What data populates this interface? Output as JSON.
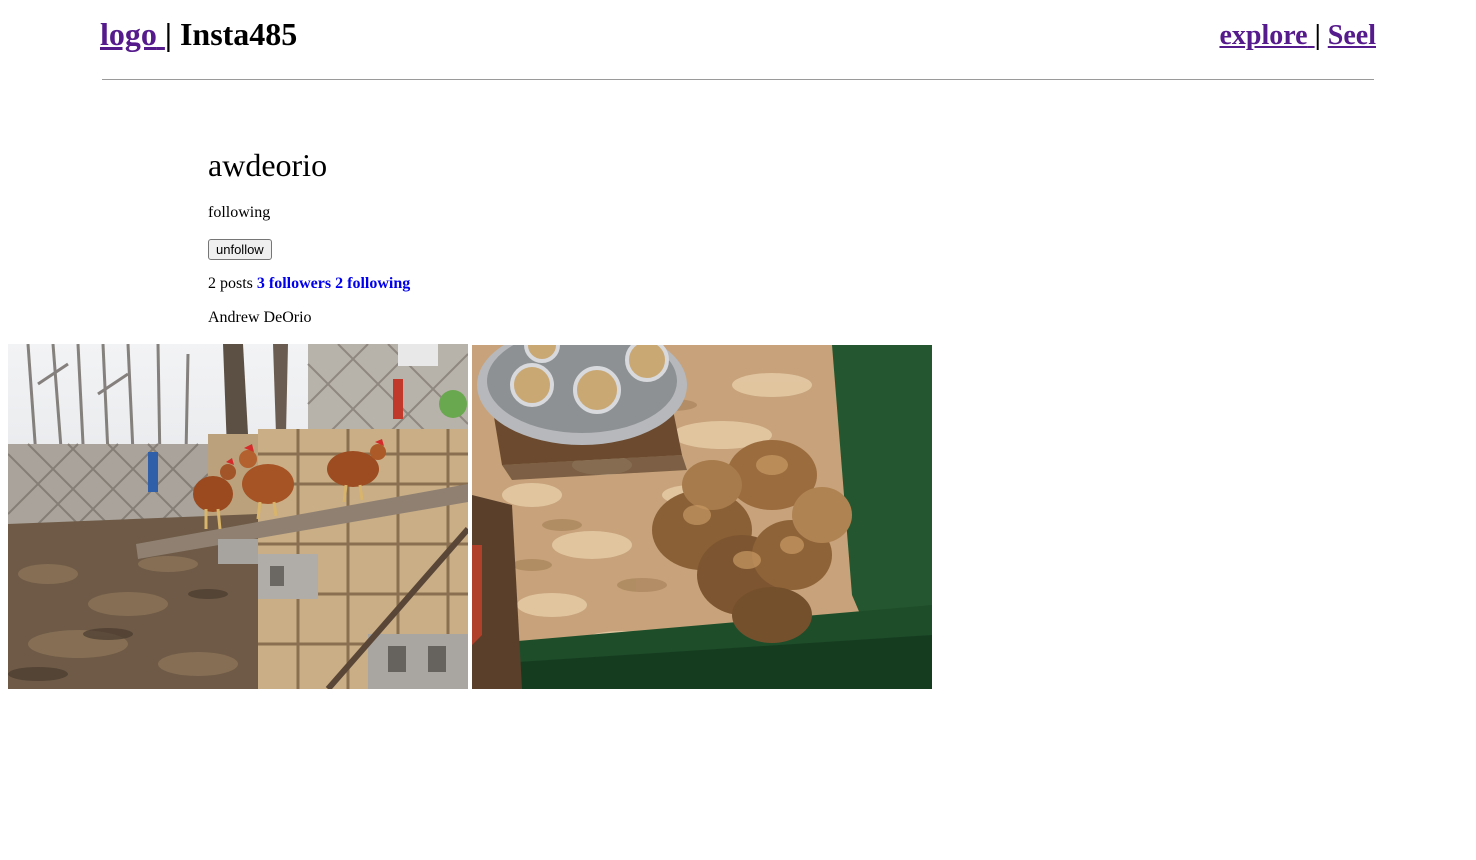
{
  "header": {
    "logo_link": "logo",
    "separator": "|",
    "app_name": "Insta485",
    "explore_link": "explore",
    "user_link": "Seel"
  },
  "profile": {
    "username": "awdeorio",
    "relationship": "following",
    "unfollow_button": "unfollow",
    "post_count_text": "2 posts",
    "followers_text": "3 followers",
    "following_text": "2 following",
    "full_name": "Andrew DeOrio"
  },
  "posts": [
    {
      "description": "chickens-on-pallets-photo"
    },
    {
      "description": "chicks-in-brooder-photo"
    }
  ],
  "colors": {
    "link_visited": "#551a8b",
    "link_blue": "#0000ee",
    "rule": "#9a9a9a"
  }
}
